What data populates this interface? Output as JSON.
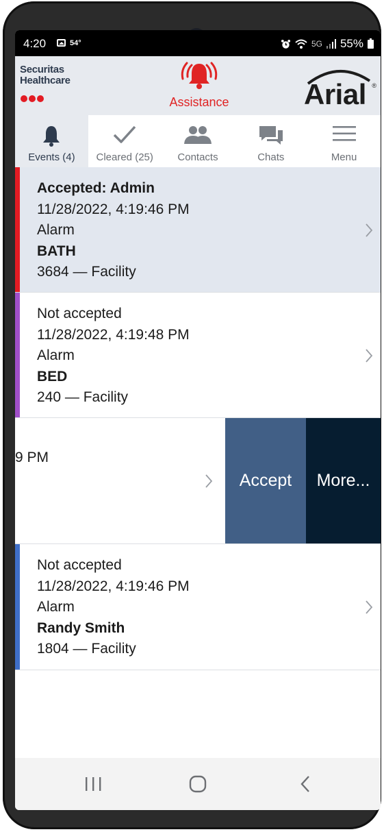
{
  "status_bar": {
    "time": "4:20",
    "temperature": "54°",
    "network": "5G",
    "battery": "55%"
  },
  "header": {
    "brand_line1": "Securitas",
    "brand_line2": "Healthcare",
    "assistance_label": "Assistance",
    "logo_text": "Arial",
    "logo_mark": "®",
    "accent_color": "#e02424"
  },
  "tabs": [
    {
      "label": "Events (4)",
      "icon": "bell-icon",
      "active": true
    },
    {
      "label": "Cleared (25)",
      "icon": "checkmark-icon",
      "active": false
    },
    {
      "label": "Contacts",
      "icon": "contacts-icon",
      "active": false
    },
    {
      "label": "Chats",
      "icon": "chat-icon",
      "active": false
    },
    {
      "label": "Menu",
      "icon": "hamburger-menu-icon",
      "active": false
    }
  ],
  "events": [
    {
      "status": "Accepted: Admin",
      "timestamp": "11/28/2022, 4:19:46 PM",
      "type": "Alarm",
      "location": "BATH",
      "detail": "3684 — Facility",
      "bar_color": "#e31b23",
      "background": "#e2e7ef"
    },
    {
      "status": "Not accepted",
      "timestamp": "11/28/2022, 4:19:48 PM",
      "type": "Alarm",
      "location": "BED",
      "detail": "240 — Facility",
      "bar_color": "#a14fc9",
      "background": "#ffffff"
    },
    {
      "partial_text": "9 PM",
      "actions": {
        "accept": "Accept",
        "more": "More..."
      }
    },
    {
      "status": "Not accepted",
      "timestamp": "11/28/2022, 4:19:46 PM",
      "type": "Alarm",
      "location": "Randy Smith",
      "detail": "1804 — Facility",
      "bar_color": "#3f6fc9",
      "background": "#ffffff"
    }
  ],
  "nav": {
    "recents": "recent-apps-icon",
    "home": "home-icon",
    "back": "back-icon"
  }
}
